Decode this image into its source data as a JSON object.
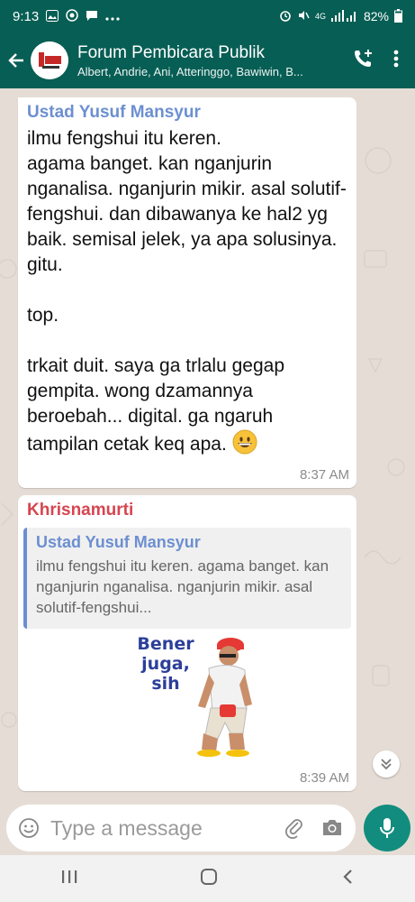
{
  "status_bar": {
    "time": "9:13",
    "battery": "82%",
    "network": "4G"
  },
  "header": {
    "title": "Forum Pembicara Publik",
    "members": "Albert, Andrie, Ani, Atteringgo, Bawiwin, B..."
  },
  "messages": [
    {
      "sender": "Ustad Yusuf Mansyur",
      "text": "ilmu fengshui itu keren.\nagama banget. kan nganjurin nganalisa. nganjurin mikir. asal solutif-fengshui. dan dibawanya ke hal2 yg baik. semisal jelek, ya apa solusinya. gitu.\n\ntop.\n\ntrkait duit. saya ga trlalu gegap gempita. wong dzamannya beroebah... digital. ga ngaruh tampilan cetak keq apa.",
      "time": "8:37 AM"
    },
    {
      "sender": "Khrisnamurti",
      "quote_sender": "Ustad Yusuf Mansyur",
      "quote_text": "ilmu fengshui itu keren. agama banget. kan nganjurin nganalisa. nganjurin mikir. asal solutif-fengshui...",
      "sticker_text": "Bener juga, sih",
      "time": "8:39 AM"
    }
  ],
  "input": {
    "placeholder": "Type a message"
  },
  "colors": {
    "header": "#075e54",
    "accent": "#128c7e",
    "quote_sender": "#6c8fd1",
    "sender_2": "#d6454f"
  }
}
